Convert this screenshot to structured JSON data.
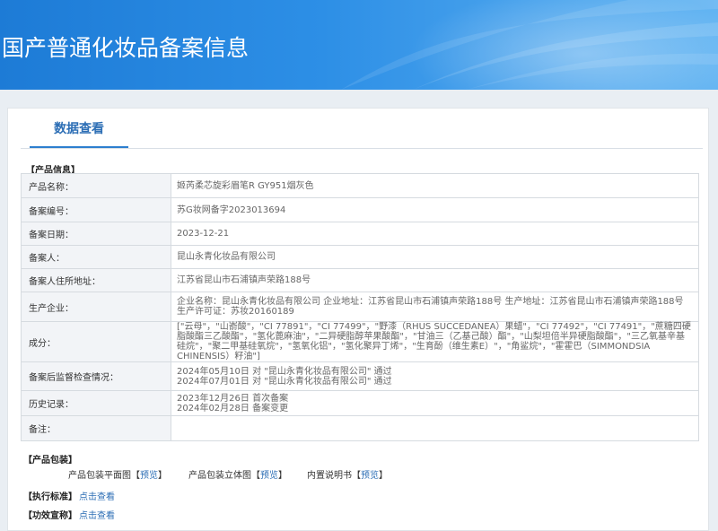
{
  "header": {
    "title": "国产普通化妆品备案信息"
  },
  "tab": {
    "label": "数据查看"
  },
  "product_info": {
    "section_label": "【产品信息】",
    "rows": [
      {
        "key": "产品名称：",
        "value": "姬芮柔芯旋彩眉笔R GY951烟灰色"
      },
      {
        "key": "备案编号：",
        "value": "苏G妆网备字2023013694"
      },
      {
        "key": "备案日期：",
        "value": "2023-12-21"
      },
      {
        "key": "备案人：",
        "value": "昆山永青化妆品有限公司"
      },
      {
        "key": "备案人住所地址：",
        "value": "江苏省昆山市石浦镇声荣路188号"
      },
      {
        "key": "生产企业：",
        "value": "企业名称：昆山永青化妆品有限公司 企业地址：江苏省昆山市石浦镇声荣路188号 生产地址：江苏省昆山市石浦镇声荣路188号 生产许可证：苏妆20160189"
      },
      {
        "key": "成分：",
        "value": "[\"云母\"，\"山嵛酸\"，\"CI 77891\"，\"CI 77499\"，\"野漆（RHUS SUCCEDANEA）果蜡\"，\"CI 77492\"，\"CI 77491\"，\"蔗糖四硬脂酸酯三乙酸酯\"，\"氢化蓖麻油\"，\"二异硬脂醇苹果酸酯\"，\"甘油三（乙基己酸）酯\"，\"山梨坦倍半异硬脂酸酯\"，\"三乙氧基辛基硅烷\"，\"聚二甲基硅氧烷\"，\"氢氧化铝\"，\"氢化聚异丁烯\"，\"生育酚（维生素E）\"，\"角鲨烷\"，\"霍霍巴（SIMMONDSIA CHINENSIS）籽油\"]"
      },
      {
        "key": "备案后监督检查情况：",
        "value_lines": [
          "2024年05月10日 对 \"昆山永青化妆品有限公司\" 通过",
          "2024年07月01日 对 \"昆山永青化妆品有限公司\" 通过"
        ]
      },
      {
        "key": "历史记录：",
        "value_lines": [
          "2023年12月26日 首次备案",
          "2024年02月28日 备案变更"
        ]
      },
      {
        "key": "备注：",
        "value": ""
      }
    ]
  },
  "packaging": {
    "section_label": "【产品包装】",
    "items": [
      {
        "label": "产品包装平面图",
        "link": "预览"
      },
      {
        "label": "产品包装立体图",
        "link": "预览"
      },
      {
        "label": "内置说明书",
        "link": "预览"
      }
    ]
  },
  "standard": {
    "section_label": "【执行标准】",
    "link": "点击查看"
  },
  "efficacy": {
    "section_label": "【功效宣称】",
    "link": "点击查看"
  },
  "colors": {
    "header_from": "#1d7bd6",
    "header_to": "#62b4f2",
    "link": "#2c6eb5",
    "key_bg": "#f2f4f7"
  }
}
